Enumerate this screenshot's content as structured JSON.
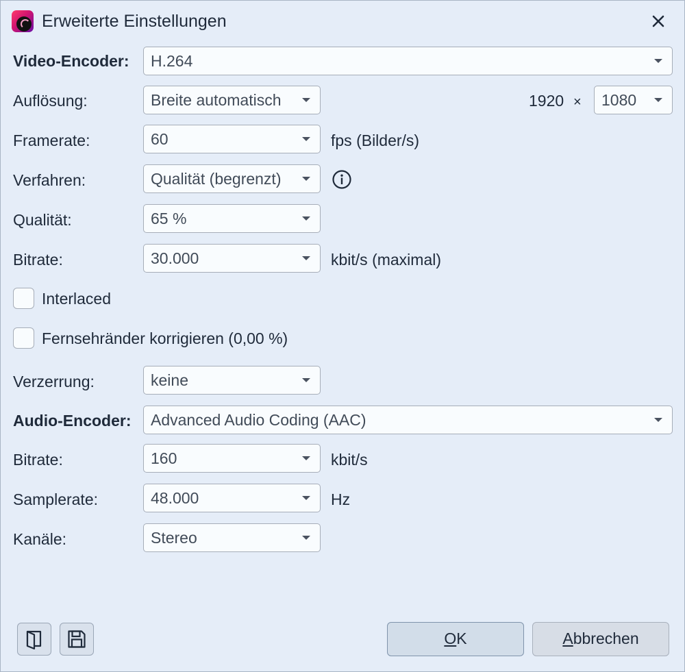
{
  "window": {
    "title": "Erweiterte Einstellungen"
  },
  "video": {
    "encoder_label": "Video-Encoder:",
    "encoder_value": "H.264",
    "resolution_label": "Auflösung:",
    "resolution_value": "Breite automatisch",
    "width_value": "1920",
    "times_symbol": "×",
    "height_value": "1080",
    "framerate_label": "Framerate:",
    "framerate_value": "60",
    "framerate_unit": "fps (Bilder/s)",
    "method_label": "Verfahren:",
    "method_value": "Qualität (begrenzt)",
    "quality_label": "Qualität:",
    "quality_value": "65 %",
    "bitrate_label": "Bitrate:",
    "bitrate_value": "30.000",
    "bitrate_unit": "kbit/s (maximal)",
    "interlaced_label": "Interlaced",
    "interlaced_checked": false,
    "tv_borders_label": "Fernsehränder korrigieren (0,00 %)",
    "tv_borders_checked": false,
    "distortion_label": "Verzerrung:",
    "distortion_value": "keine"
  },
  "audio": {
    "encoder_label": "Audio-Encoder:",
    "encoder_value": "Advanced Audio Coding (AAC)",
    "bitrate_label": "Bitrate:",
    "bitrate_value": "160",
    "bitrate_unit": "kbit/s",
    "samplerate_label": "Samplerate:",
    "samplerate_value": "48.000",
    "samplerate_unit": "Hz",
    "channels_label": "Kanäle:",
    "channels_value": "Stereo"
  },
  "buttons": {
    "ok_mnemonic": "O",
    "ok_rest": "K",
    "cancel_mnemonic": "A",
    "cancel_rest": "bbrechen"
  },
  "icons": {
    "app": "app-logo-icon",
    "close": "close-icon",
    "info": "info-icon",
    "open": "open-file-icon",
    "save": "save-icon"
  }
}
